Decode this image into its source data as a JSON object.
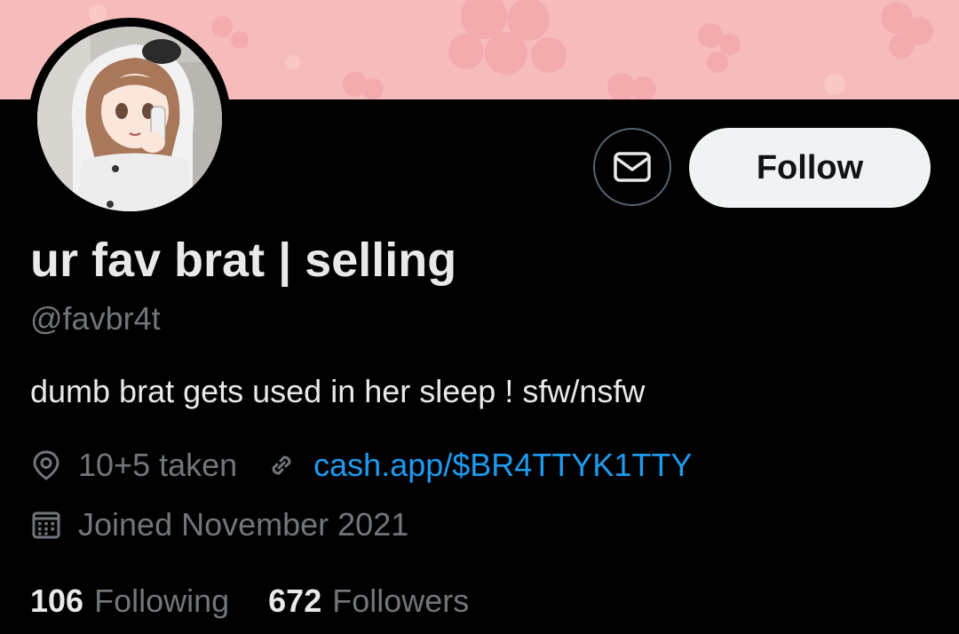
{
  "profile": {
    "display_name": "ur fav brat | selling",
    "handle": "@favbr4t",
    "bio": "dumb brat gets used in her sleep ! sfw/nsfw",
    "location": "10+5 taken",
    "website": "cash.app/$BR4TTYK1TTY",
    "joined": "Joined November 2021"
  },
  "actions": {
    "message_icon": "envelope-icon",
    "follow_label": "Follow"
  },
  "stats": {
    "following_count": "106",
    "following_label": "Following",
    "followers_count": "672",
    "followers_label": "Followers"
  },
  "icons": {
    "location": "location-pin-icon",
    "link": "link-icon",
    "calendar": "calendar-icon"
  },
  "colors": {
    "background": "#000000",
    "banner": "#f6bcbc",
    "text_primary": "#e7e9ea",
    "text_secondary": "#71767b",
    "link": "#1d9bf0",
    "follow_button_bg": "#eff3f4"
  }
}
